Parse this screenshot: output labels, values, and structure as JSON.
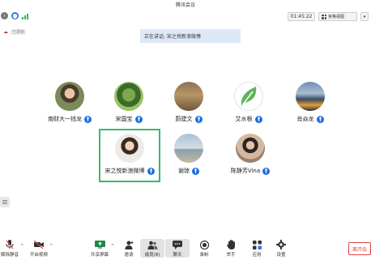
{
  "window": {
    "title": "腾讯会议"
  },
  "topbar": {
    "timer": "01:45:22",
    "view_label": "宫格视图"
  },
  "record": {
    "tag": "已录制"
  },
  "speaking": {
    "text": "正在讲话: 宋之悦新浪微博"
  },
  "participants": [
    {
      "name": "南财大一钱龙"
    },
    {
      "name": "宋国宝"
    },
    {
      "name": "蔚建文"
    },
    {
      "name": "艾水根"
    },
    {
      "name": "肖焱龙"
    },
    {
      "name": "宋之悦新浪微博"
    },
    {
      "name": "谢琼"
    },
    {
      "name": "陈静芳Vina"
    }
  ],
  "toolbar": {
    "mute": "解除静音",
    "video": "开启视频",
    "share": "共享屏幕",
    "invite": "邀请",
    "members": "成员(8)",
    "chat": "聊天",
    "record": "录制",
    "raise_hand": "举手",
    "apps": "应用",
    "settings": "设置",
    "leave": "离开会"
  },
  "colors": {
    "accent": "#1f6fe0",
    "active_border": "#39b86b",
    "leave": "#e04646"
  }
}
